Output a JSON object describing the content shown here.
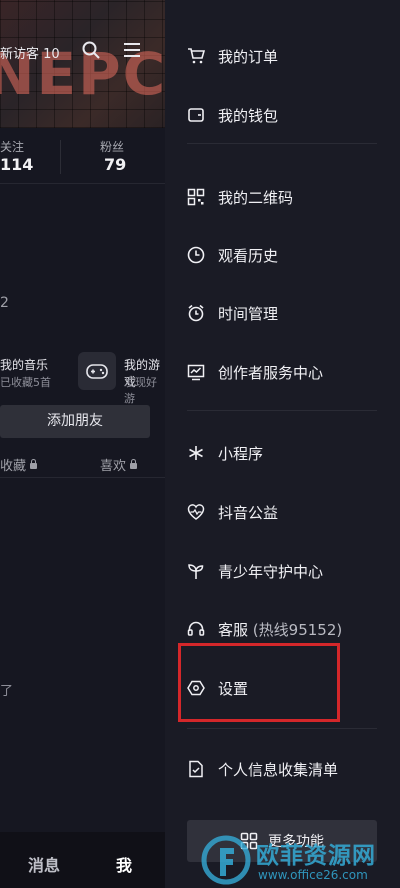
{
  "profile": {
    "visitor_text": "新访客 10",
    "stats": [
      {
        "label": "关注",
        "value": "114"
      },
      {
        "label": "粉丝",
        "value": "79"
      }
    ],
    "section_fragment": "2",
    "music": {
      "title": "我的音乐",
      "sub": "已收藏5首"
    },
    "game": {
      "title": "我的游戏",
      "sub": "发现好游"
    },
    "add_friend_label": "添加朋友",
    "tabs": [
      {
        "label": "收藏"
      },
      {
        "label": "喜欢"
      }
    ],
    "empty_fragment": "了"
  },
  "bottom_nav": {
    "messages": "消息",
    "me": "我"
  },
  "drawer": {
    "items": [
      {
        "label": "我的订单",
        "icon": "cart-icon"
      },
      {
        "label": "我的钱包",
        "icon": "wallet-icon"
      },
      {
        "label": "我的二维码",
        "icon": "qrcode-icon"
      },
      {
        "label": "观看历史",
        "icon": "clock-icon"
      },
      {
        "label": "时间管理",
        "icon": "alarm-icon"
      },
      {
        "label": "创作者服务中心",
        "icon": "chart-icon"
      },
      {
        "label": "小程序",
        "icon": "asterisk-icon"
      },
      {
        "label": "抖音公益",
        "icon": "heart-pulse-icon"
      },
      {
        "label": "青少年守护中心",
        "icon": "sprout-icon"
      },
      {
        "label": "客服",
        "sub": "(热线95152)",
        "icon": "headset-icon"
      },
      {
        "label": "设置",
        "icon": "hexagon-settings-icon"
      },
      {
        "label": "个人信息收集清单",
        "icon": "document-icon"
      }
    ],
    "more_label": "更多功能"
  },
  "watermark": {
    "title": "欧菲资源网",
    "url": "www.office26.com"
  },
  "colors": {
    "highlight": "#d4272a",
    "drawer_bg": "#1a1b25",
    "watermark": "#34aad6"
  }
}
